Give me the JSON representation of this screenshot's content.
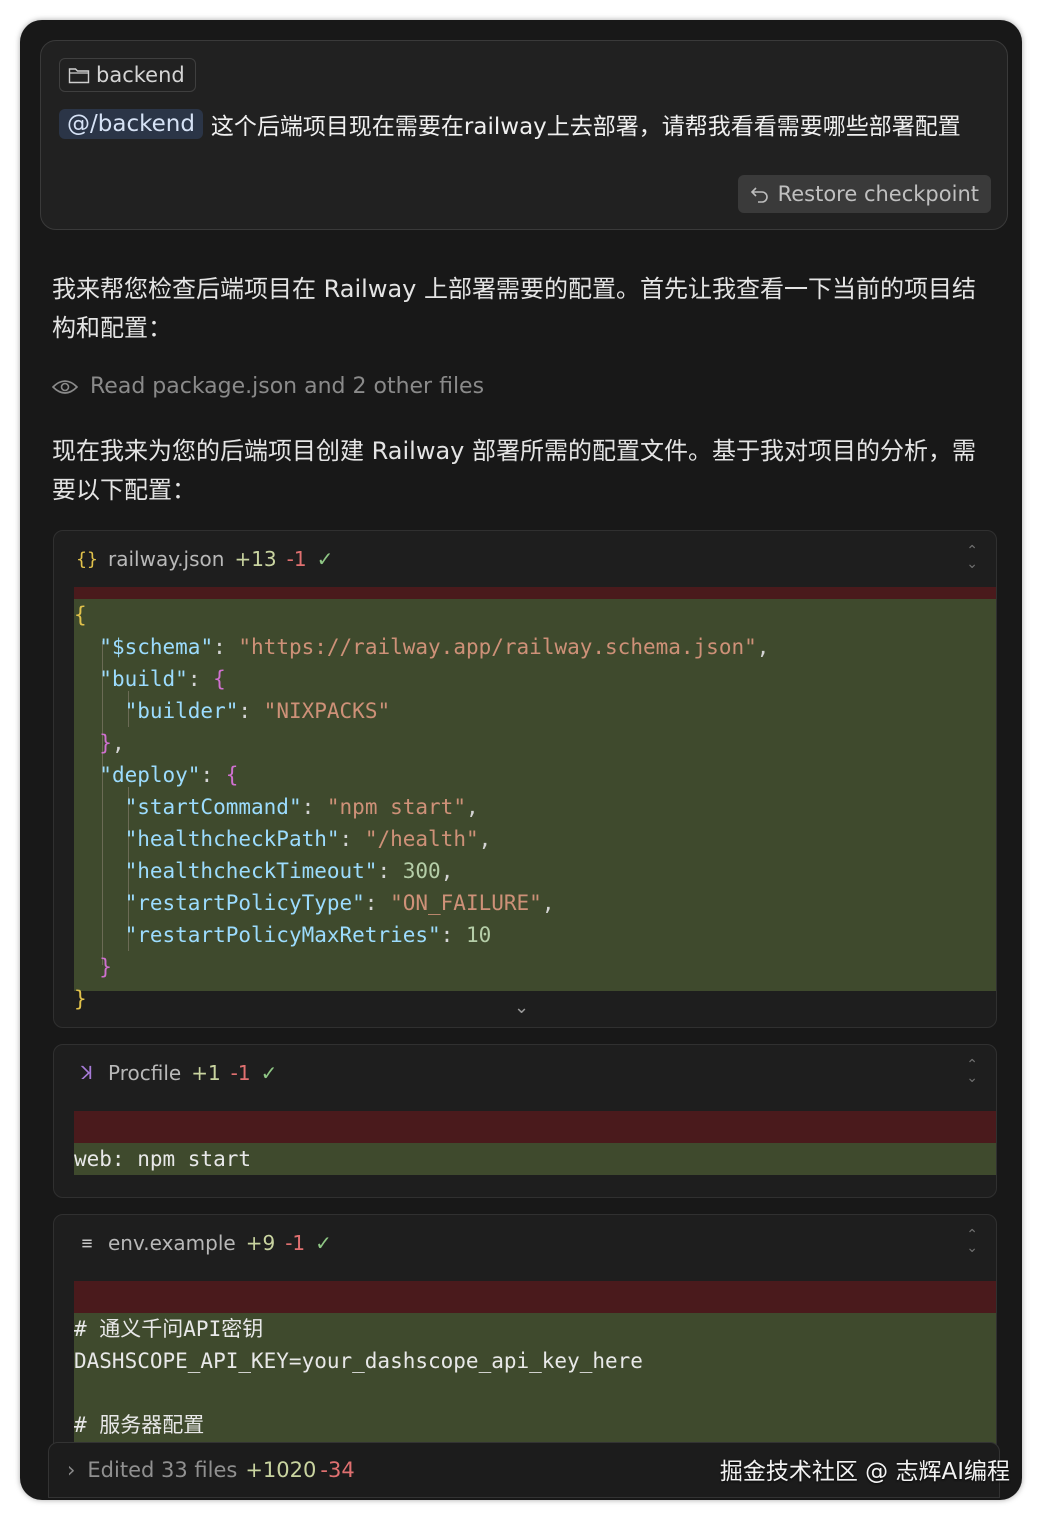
{
  "prompt": {
    "context_chip": "backend",
    "mention": "@/backend",
    "text": "这个后端项目现在需要在railway上去部署，请帮我看看需要哪些部署配置",
    "restore_label": "Restore checkpoint"
  },
  "response": {
    "para1": "我来帮您检查后端项目在 Railway 上部署需要的配置。首先让我查看一下当前的项目结构和配置：",
    "read_status": "Read package.json and 2 other files",
    "para2": "现在我来为您的后端项目创建 Railway 部署所需的配置文件。基于我对项目的分析，需要以下配置："
  },
  "diffs": [
    {
      "icon": "{}",
      "filename": "railway.json",
      "added": "+13",
      "removed": "-1"
    },
    {
      "icon": "ꓘ",
      "filename": "Procfile",
      "added": "+1",
      "removed": "-1",
      "code": "web: npm start"
    },
    {
      "icon": "≡",
      "filename": "env.example",
      "added": "+9",
      "removed": "-1",
      "lines": [
        "# 通义千问API密钥",
        "DASHSCOPE_API_KEY=your_dashscope_api_key_here",
        "",
        "# 服务器配置"
      ]
    }
  ],
  "railway_json": {
    "schema_key": "\"$schema\"",
    "schema_val": "\"https://railway.app/railway.schema.json\"",
    "build_key": "\"build\"",
    "builder_key": "\"builder\"",
    "builder_val": "\"NIXPACKS\"",
    "deploy_key": "\"deploy\"",
    "start_key": "\"startCommand\"",
    "start_val": "\"npm start\"",
    "hc_path_key": "\"healthcheckPath\"",
    "hc_path_val": "\"/health\"",
    "hc_timeout_key": "\"healthcheckTimeout\"",
    "hc_timeout_val": "300",
    "restart_type_key": "\"restartPolicyType\"",
    "restart_type_val": "\"ON_FAILURE\"",
    "restart_max_key": "\"restartPolicyMaxRetries\"",
    "restart_max_val": "10"
  },
  "footer": {
    "summary": "Edited 33 files",
    "added": "+1020",
    "removed": "-34"
  },
  "watermark": "掘金技术社区 @ 志辉AI编程"
}
